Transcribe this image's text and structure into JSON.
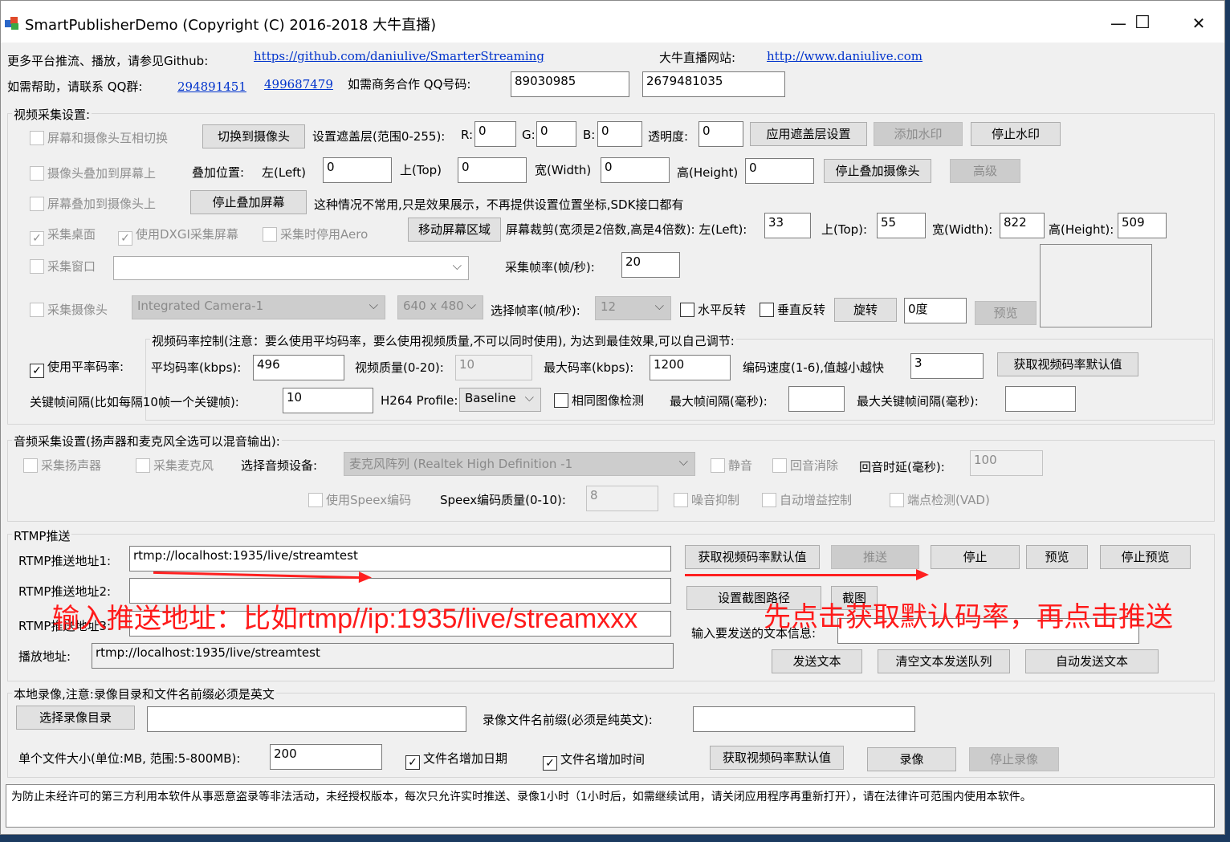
{
  "window": {
    "title": "SmartPublisherDemo  (Copyright (C) 2016-2018 大牛直播)",
    "minimize": "—",
    "maximize": "☐",
    "close": "✕"
  },
  "header": {
    "github_label": "更多平台推流、播放，请参见Github:",
    "github_link": "https://github.com/daniulive/SmarterStreaming",
    "site_label": "大牛直播网站:",
    "site_link": "http://www.daniulive.com",
    "help_label": "如需帮助，请联系 QQ群:",
    "qq_group1": "294891451",
    "qq_group2": "499687479",
    "biz_label": "如需商务合作 QQ号码:",
    "qq1": "89030985",
    "qq2": "2679481035"
  },
  "video": {
    "title": "视频采集设置:",
    "switch_cb": "屏幕和摄像头互相切换",
    "switch_btn": "切换到摄像头",
    "mask_label": "设置遮盖层(范围0-255):",
    "r": "R:",
    "r_val": "0",
    "g": "G:",
    "g_val": "0",
    "b": "B:",
    "b_val": "0",
    "alpha": "透明度:",
    "alpha_val": "0",
    "apply_mask": "应用遮盖层设置",
    "add_wm": "添加水印",
    "stop_wm": "停止水印",
    "cam_on_screen": "摄像头叠加到屏幕上",
    "overlay_pos": "叠加位置:",
    "left": "左(Left)",
    "left_val": "0",
    "top": "上(Top)",
    "top_val": "0",
    "width": "宽(Width)",
    "width_val": "0",
    "height": "高(Height)",
    "height_val": "0",
    "stop_cam_overlay": "停止叠加摄像头",
    "advanced": "高级",
    "screen_on_cam": "屏幕叠加到摄像头上",
    "stop_screen_overlay": "停止叠加屏幕",
    "note": "这种情况不常用,只是效果展示，不再提供设置位置坐标,SDK接口都有",
    "desktop": "采集桌面",
    "dxgi": "使用DXGI采集屏幕",
    "aero": "采集时停用Aero",
    "move_region": "移动屏幕区域",
    "crop_label": "屏幕裁剪(宽须是2倍数,高是4倍数): 左(Left):",
    "crop_left": "33",
    "crop_top_lbl": "上(Top):",
    "crop_top": "55",
    "crop_w_lbl": "宽(Width):",
    "crop_w": "822",
    "crop_h_lbl": "高(Height):",
    "crop_h": "509",
    "window_cb": "采集窗口",
    "fps_label": "采集帧率(帧/秒):",
    "fps_val": "20",
    "camera_cb": "采集摄像头",
    "camera_sel": "Integrated Camera-1",
    "res_sel": "640 x 480",
    "cam_fps_label": "选择帧率(帧/秒):",
    "cam_fps_sel": "12",
    "hflip": "水平反转",
    "vflip": "垂直反转",
    "rotate": "旋转",
    "rotate_val": "0度",
    "preview": "预览",
    "bitrate_title": "视频码率控制(注意：要么使用平均码率，要么使用视频质量,不可以同时使用), 为达到最佳效果,可以自己调节:",
    "use_avg": "使用平率码率:",
    "avg_label": "平均码率(kbps):",
    "avg_val": "496",
    "quality_label": "视频质量(0-20):",
    "quality_val": "10",
    "max_label": "最大码率(kbps):",
    "max_val": "1200",
    "speed_label": "编码速度(1-6),值越小越快",
    "speed_val": "3",
    "get_default": "获取视频码率默认值",
    "gop_label": "关键帧间隔(比如每隔10帧一个关键帧):",
    "gop_val": "10",
    "profile_label": "H264 Profile:",
    "profile_sel": "Baseline",
    "same_img": "相同图像检测",
    "max_interval": "最大帧间隔(毫秒):",
    "max_key_interval": "最大关键帧间隔(毫秒):"
  },
  "audio": {
    "title": "音频采集设置(扬声器和麦克风全选可以混音输出):",
    "speaker": "采集扬声器",
    "mic": "采集麦克风",
    "device_label": "选择音频设备:",
    "device_sel": "麦克风阵列 (Realtek High Definition -1",
    "mute": "静音",
    "aec": "回音消除",
    "delay_label": "回音时延(毫秒):",
    "delay_val": "100",
    "speex": "使用Speex编码",
    "speex_q_label": "Speex编码质量(0-10):",
    "speex_q_val": "8",
    "ns": "噪音抑制",
    "agc": "自动增益控制",
    "vad": "端点检测(VAD)"
  },
  "rtmp": {
    "title": "RTMP推送",
    "url1_label": "RTMP推送地址1:",
    "url1": "rtmp://localhost:1935/live/streamtest",
    "url2_label": "RTMP推送地址2:",
    "url3_label": "RTMP推送地址3:",
    "play_label": "播放地址:",
    "play_url": "rtmp://localhost:1935/live/streamtest",
    "get_default": "获取视频码率默认值",
    "push": "推送",
    "stop": "停止",
    "preview": "预览",
    "stop_preview": "停止预览",
    "snap_path": "设置截图路径",
    "snap": "截图",
    "text_label": "输入要发送的文本信息:",
    "send_text": "发送文本",
    "clear_queue": "清空文本发送队列",
    "auto_send": "自动发送文本"
  },
  "overlay": {
    "hint1": "输入推送地址：比如rtmp//ip:1935/live/streamxxx",
    "hint2": "先点击获取默认码率，再点击推送",
    "color": "#ff1a1a"
  },
  "record": {
    "title": "本地录像,注意:录像目录和文件名前缀必须是英文",
    "choose_dir": "选择录像目录",
    "prefix_label": "录像文件名前缀(必须是纯英文):",
    "size_label": "单个文件大小(单位:MB, 范围:5-800MB):",
    "size_val": "200",
    "add_date": "文件名增加日期",
    "add_time": "文件名增加时间",
    "get_default": "获取视频码率默认值",
    "record": "录像",
    "stop_record": "停止录像"
  },
  "notice": "为防止未经许可的第三方利用本软件从事恶意盗录等非法活动，未经授权版本，每次只允许实时推送、录像1小时（1小时后，如需继续试用，请关闭应用程序再重新打开），请在法律许可范围内使用本软件。"
}
